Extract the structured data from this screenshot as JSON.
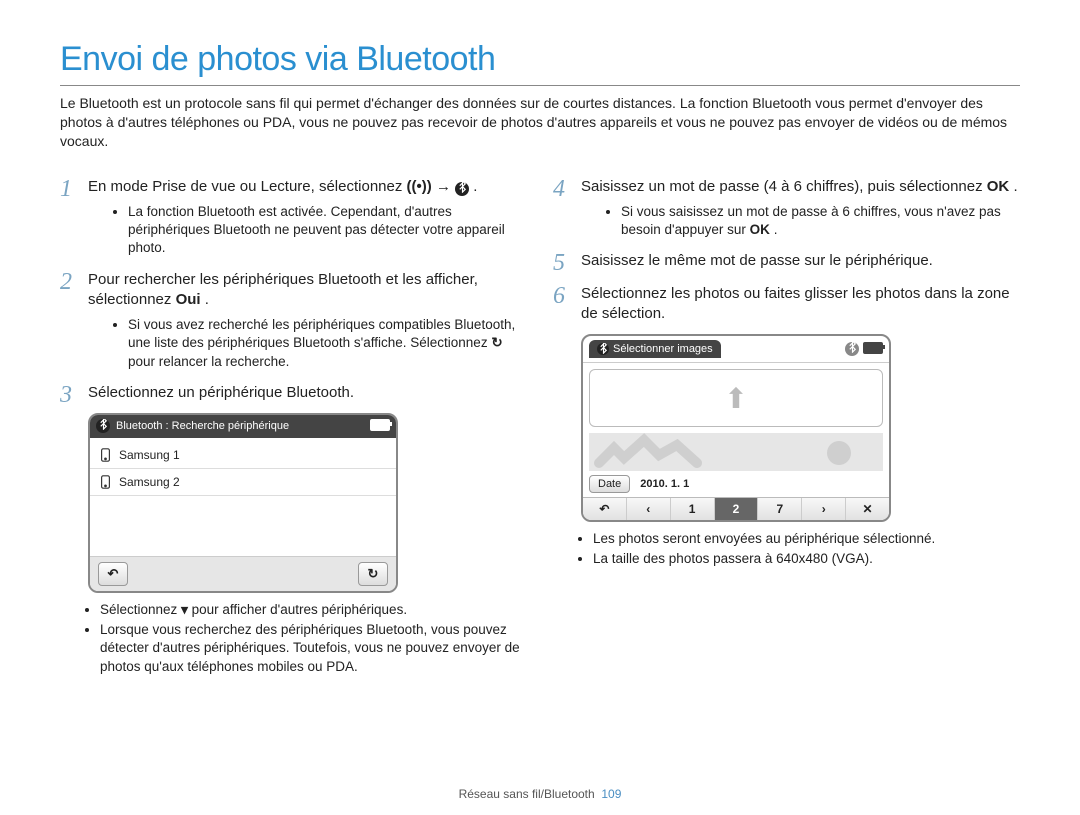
{
  "title": "Envoi de photos via Bluetooth",
  "intro": "Le Bluetooth est un protocole sans fil qui permet d'échanger des données sur de courtes distances. La fonction Bluetooth vous permet d'envoyer des photos à d'autres téléphones ou PDA, vous ne pouvez pas recevoir de photos d'autres appareils et vous ne pouvez pas envoyer de vidéos ou de mémos vocaux.",
  "left": {
    "step1": {
      "num": "1",
      "text_a": "En mode Prise de vue ou Lecture, sélectionnez ",
      "text_arrow": " → ",
      "text_b": ".",
      "sub": [
        "La fonction Bluetooth est activée. Cependant, d'autres périphériques Bluetooth ne peuvent pas détecter votre appareil photo."
      ]
    },
    "step2": {
      "num": "2",
      "text_a": "Pour rechercher les périphériques Bluetooth et les afficher, sélectionnez ",
      "text_b": "Oui",
      "text_c": ".",
      "sub_a": "Si vous avez recherché les périphériques compatibles Bluetooth, une liste des périphériques Bluetooth s'affiche. Sélectionnez ",
      "sub_b": " pour relancer la recherche."
    },
    "step3": {
      "num": "3",
      "text": "Sélectionnez un périphérique Bluetooth."
    },
    "bt_screenshot": {
      "header": "Bluetooth : Recherche périphérique",
      "items": [
        "Samsung 1",
        "Samsung 2"
      ]
    },
    "after_ss": {
      "a_pre": "Sélectionnez ",
      "a_post": " pour afficher d'autres périphériques.",
      "b": "Lorsque vous recherchez des périphériques Bluetooth, vous pouvez détecter d'autres périphériques. Toutefois, vous ne pouvez envoyer de photos qu'aux téléphones mobiles ou PDA."
    }
  },
  "right": {
    "step4": {
      "num": "4",
      "text_a": "Saisissez un mot de passe (4 à 6 chiffres), puis sélectionnez ",
      "text_b": "OK",
      "text_c": ".",
      "sub_a": "Si vous saisissez un mot de passe à 6 chiffres, vous n'avez pas besoin d'appuyer sur ",
      "sub_b": "OK",
      "sub_c": "."
    },
    "step5": {
      "num": "5",
      "text": "Saisissez le même mot de passe sur le périphérique."
    },
    "step6": {
      "num": "6",
      "text": "Sélectionnez les photos ou faites glisser les photos dans la zone de sélection."
    },
    "img_screenshot": {
      "tab": "Sélectionner images",
      "date_btn": "Date",
      "date_val": "2010. 1. 1",
      "nav": [
        "↶",
        "‹",
        "1",
        "2",
        "7",
        "›",
        "✕"
      ]
    },
    "after_ss": [
      "Les photos seront envoyées au périphérique sélectionné.",
      "La taille des photos passera à 640x480 (VGA)."
    ]
  },
  "footer": {
    "section": "Réseau sans fil/Bluetooth",
    "page": "109"
  }
}
